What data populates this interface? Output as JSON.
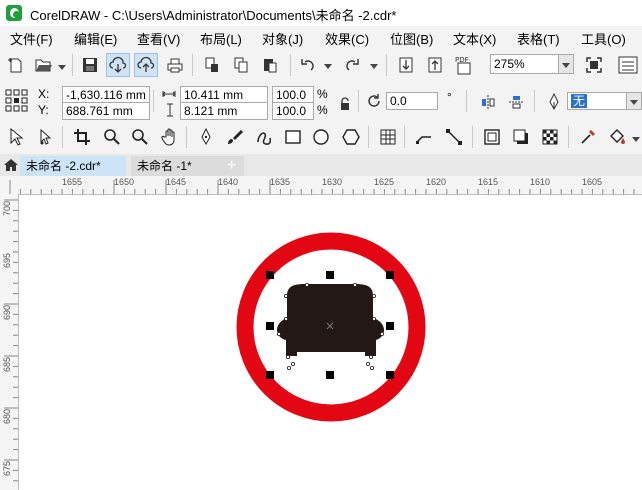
{
  "titlebar": {
    "title": "CorelDRAW - C:\\Users\\Administrator\\Documents\\未命名 -2.cdr*"
  },
  "menu": {
    "items": [
      "文件(F)",
      "编辑(E)",
      "查看(V)",
      "布局(L)",
      "对象(J)",
      "效果(C)",
      "位图(B)",
      "文本(X)",
      "表格(T)",
      "工具(O)"
    ]
  },
  "standard_toolbar": {
    "zoom_value": "275%",
    "pdf_label": "PDF"
  },
  "property_bar": {
    "x_label": "X:",
    "y_label": "Y:",
    "x_value": "-1,630.116 mm",
    "y_value": "688.761 mm",
    "width_value": "10.411 mm",
    "height_value": "8.121 mm",
    "scale_w": "100.0",
    "scale_h": "100.0",
    "percent": "%",
    "rotation_value": "0.0",
    "degree_symbol": "°",
    "outline_value": "无"
  },
  "tabs": [
    {
      "label": "未命名 -2.cdr*",
      "active": true
    },
    {
      "label": "未命名 -1*",
      "active": false
    }
  ],
  "rulers": {
    "horizontal": [
      "1655",
      "1650",
      "1645",
      "1640",
      "1635",
      "1630",
      "1625",
      "1620",
      "1615",
      "1610",
      "1605"
    ],
    "vertical": [
      "700",
      "695",
      "690",
      "685",
      "680",
      "675"
    ]
  },
  "colors": {
    "sign_red": "#e30613",
    "car_fill": "#231815",
    "selected_tab": "#cde4f7",
    "active_button": "#cfe3f5"
  }
}
